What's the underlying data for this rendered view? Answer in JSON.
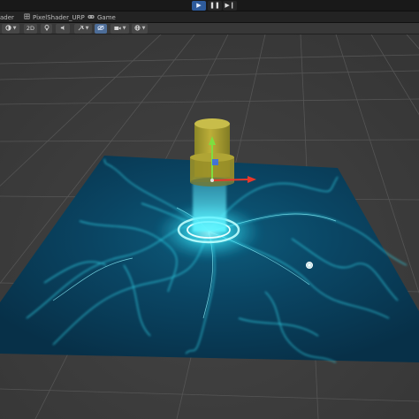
{
  "playbar": {
    "play_icon": "play-icon",
    "pause_icon": "pause-icon",
    "step_icon": "step-icon",
    "play_glyph": "▶",
    "pause_glyph": "❚❚",
    "step_glyph": "▶❙",
    "accent": "#2e5b9b"
  },
  "tabs": [
    {
      "label": "ader",
      "icon": ""
    },
    {
      "label": "PixelShader_URP",
      "icon": "scene-icon"
    },
    {
      "label": "Game",
      "icon": "game-controller-icon"
    }
  ],
  "toolbar": {
    "shading_mode_icon": "shading-mode-icon",
    "mode_2d_label": "2D",
    "lighting_icon": "light-bulb-icon",
    "audio_icon": "audio-icon",
    "effects_icon": "effects-icon",
    "hidden_objects_icon": "visibility-icon",
    "camera_icon": "camera-icon",
    "gizmos_icon": "gizmos-icon"
  },
  "colors": {
    "viewport_bg": "#3c3c3c",
    "water": "#0b3b54",
    "caustics": "#35e6ff",
    "pillar": "#b3a62c",
    "gizmo_y": "#7ede3f",
    "gizmo_x": "#e8372a",
    "gizmo_z": "#3a6ee8"
  }
}
